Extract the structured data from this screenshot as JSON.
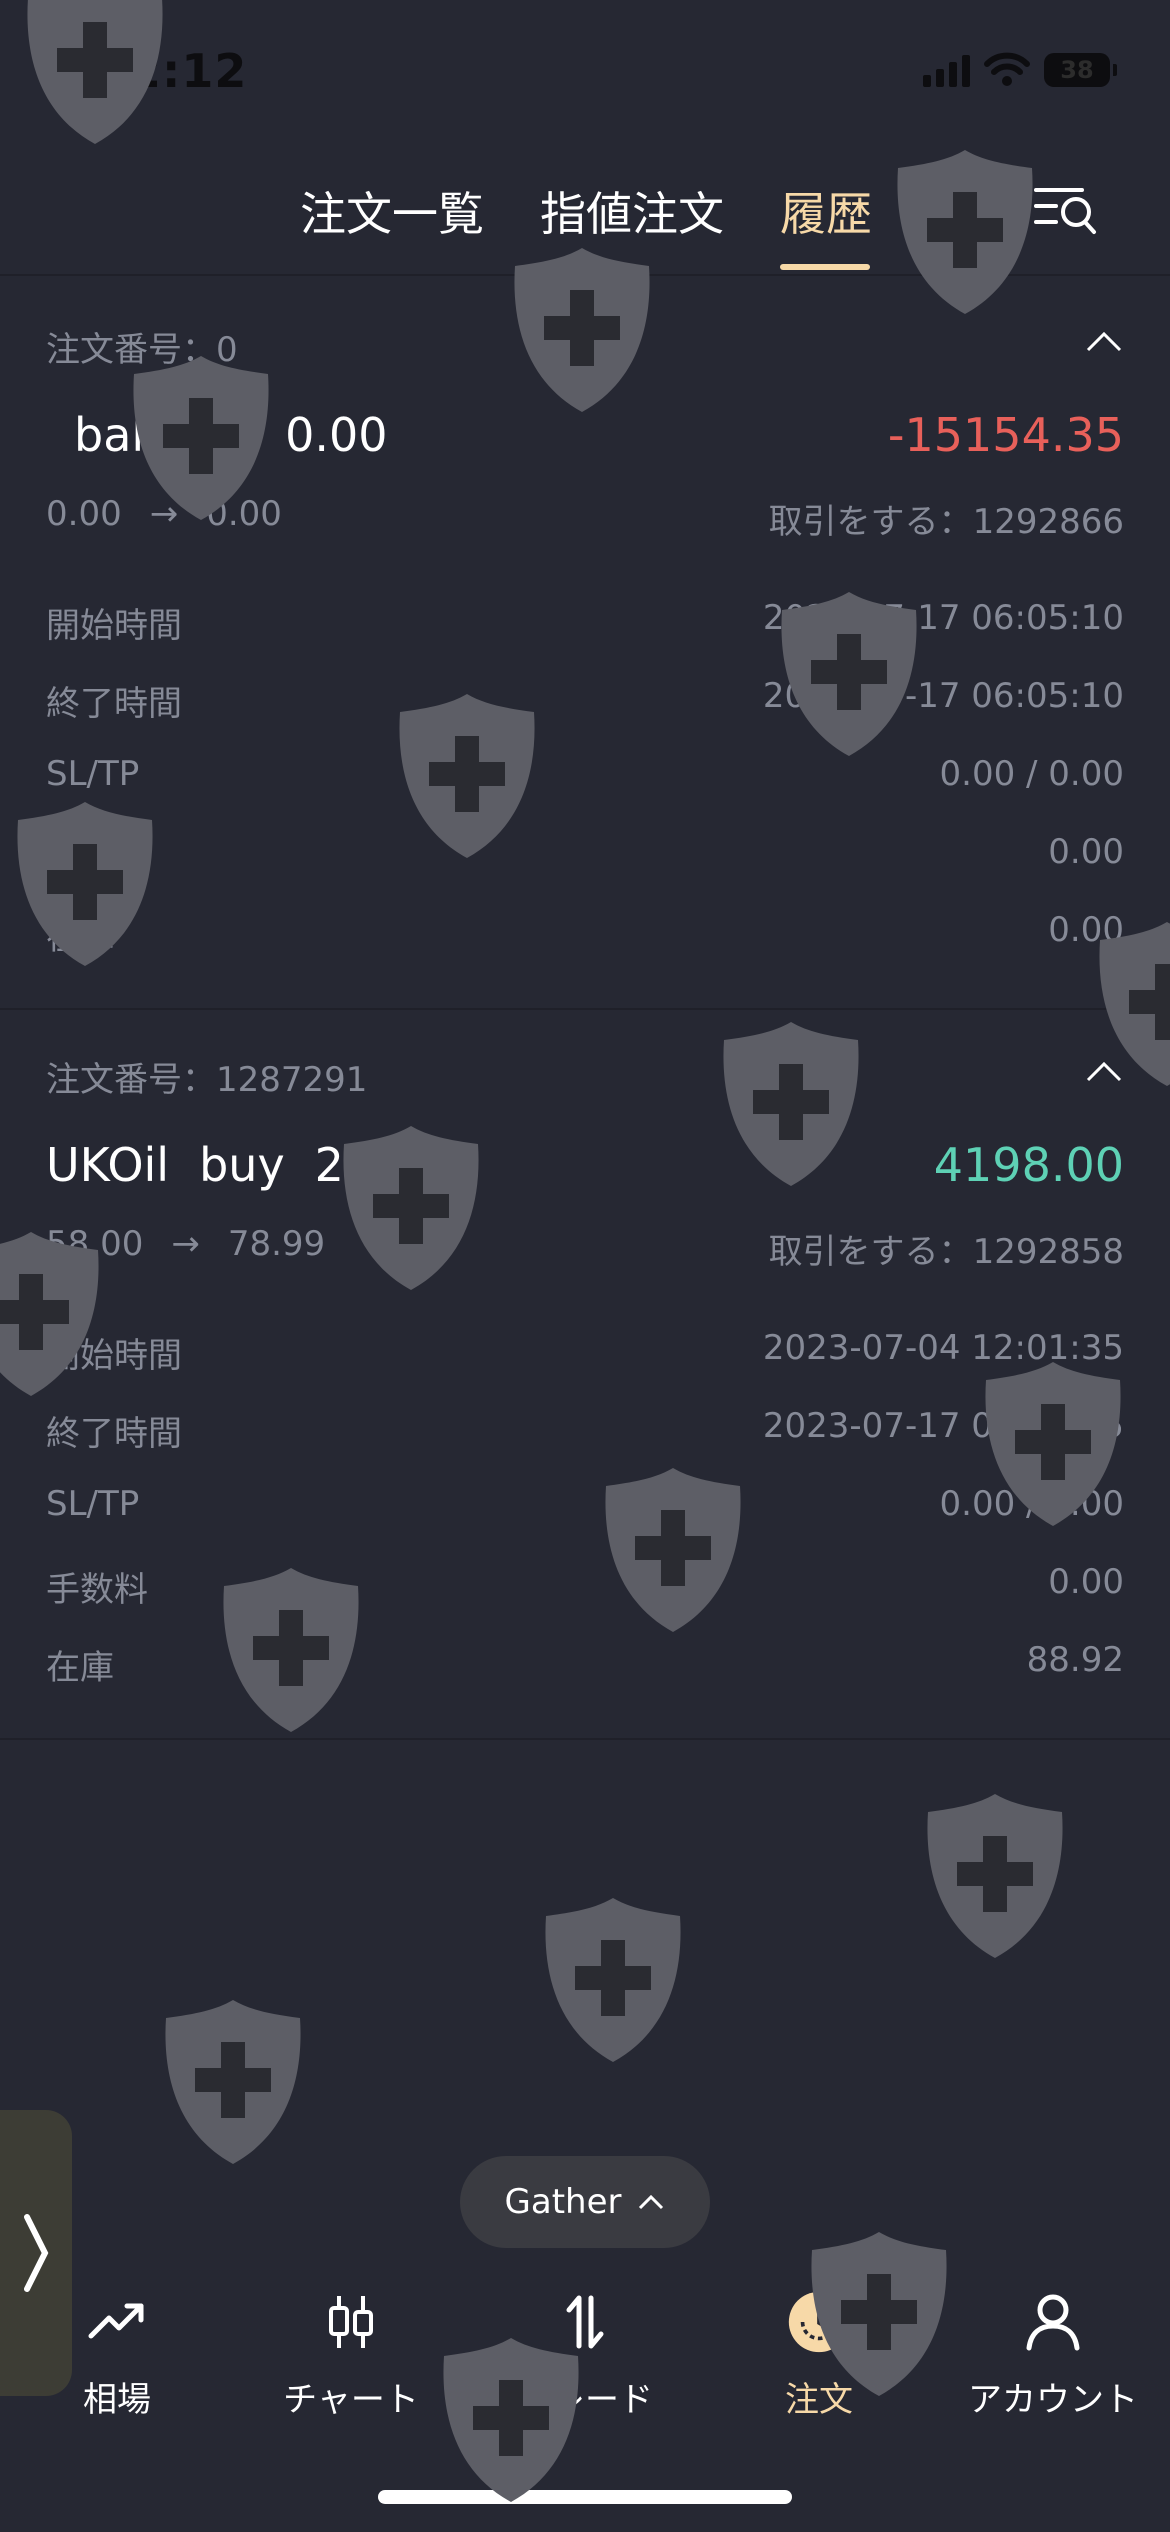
{
  "status_bar": {
    "time": "12:12",
    "battery": "38"
  },
  "tabs": [
    {
      "label": "注文一覧",
      "active": false
    },
    {
      "label": "指値注文",
      "active": false
    },
    {
      "label": "履歴",
      "active": true
    }
  ],
  "orders": [
    {
      "order_no_label": "注文番号：",
      "order_no": "0",
      "symbol": "balance",
      "side": "",
      "volume": "0.00",
      "pnl": "-15154.35",
      "pnl_color": "#e8605a",
      "open_price": "0.00",
      "close_price": "0.00",
      "arrow": "→",
      "trade_label": "取引をする：",
      "trade_id": "1292866",
      "details": [
        {
          "label": "開始時間",
          "value": "2023-07-17 06:05:10"
        },
        {
          "label": "終了時間",
          "value": "2023-07-17 06:05:10"
        },
        {
          "label": "SL/TP",
          "value": "0.00 / 0.00"
        },
        {
          "label": "手数料",
          "value": "0.00"
        },
        {
          "label": "在庫",
          "value": "0.00"
        }
      ]
    },
    {
      "order_no_label": "注文番号：",
      "order_no": "1287291",
      "symbol": "UKOil",
      "side": "buy",
      "volume": "2.00",
      "pnl": "4198.00",
      "pnl_color": "#5ed1b5",
      "open_price": "58.00",
      "close_price": "78.99",
      "arrow": "→",
      "trade_label": "取引をする：",
      "trade_id": "1292858",
      "details": [
        {
          "label": "開始時間",
          "value": "2023-07-04 12:01:35"
        },
        {
          "label": "終了時間",
          "value": "2023-07-17 06:02:25"
        },
        {
          "label": "SL/TP",
          "value": "0.00 / 0.00"
        },
        {
          "label": "手数料",
          "value": "0.00"
        },
        {
          "label": "在庫",
          "value": "88.92"
        }
      ]
    }
  ],
  "gather": {
    "label": "Gather",
    "icon": "chevron-up-icon"
  },
  "bottom_nav": [
    {
      "label": "相場",
      "icon": "trend-up-icon",
      "active": false
    },
    {
      "label": "チャート",
      "icon": "candlestick-icon",
      "active": false
    },
    {
      "label": "トレード",
      "icon": "swap-vertical-icon",
      "active": false
    },
    {
      "label": "注文",
      "icon": "history-clock-icon",
      "active": true
    },
    {
      "label": "アカウント",
      "icon": "person-icon",
      "active": false
    }
  ],
  "colors": {
    "background": "#262833",
    "accent": "#f7d9a8",
    "loss": "#e8605a",
    "profit": "#5ed1b5",
    "muted_text": "#868a97"
  }
}
